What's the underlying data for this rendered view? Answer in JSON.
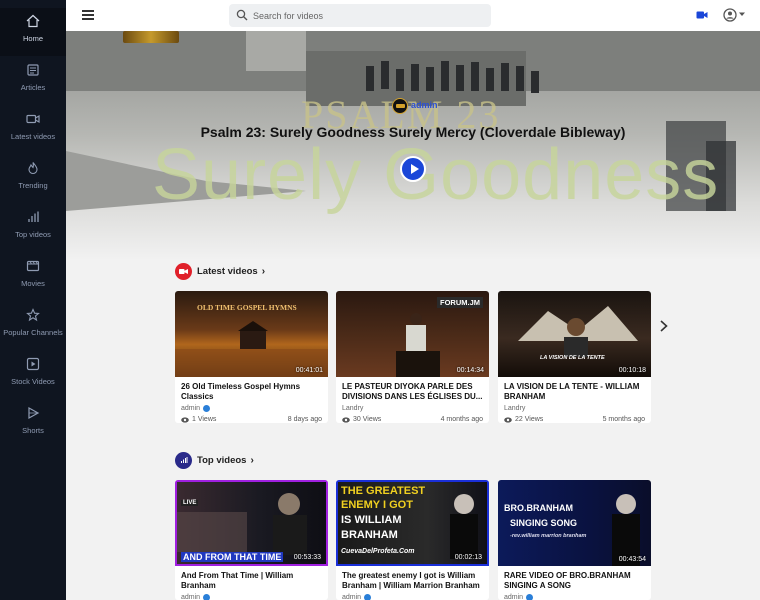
{
  "sidebar": {
    "items": [
      {
        "label": "Home",
        "icon": "home-icon"
      },
      {
        "label": "Articles",
        "icon": "article-icon"
      },
      {
        "label": "Latest videos",
        "icon": "video-camera-icon"
      },
      {
        "label": "Trending",
        "icon": "fire-icon"
      },
      {
        "label": "Top videos",
        "icon": "bar-chart-icon"
      },
      {
        "label": "Movies",
        "icon": "film-icon"
      },
      {
        "label": "Popular Channels",
        "icon": "star-icon"
      },
      {
        "label": "Stock Videos",
        "icon": "play-square-icon"
      },
      {
        "label": "Shorts",
        "icon": "shorts-icon"
      }
    ]
  },
  "header": {
    "search_placeholder": "Search for videos"
  },
  "hero": {
    "bg_text_top": "PSALM 23",
    "bg_text_big": "Surely Goodness",
    "channel": "admin",
    "title": "Psalm 23: Surely Goodness Surely Mercy (Cloverdale Bibleway)"
  },
  "latest": {
    "title": "Latest videos",
    "videos": [
      {
        "thumb_text": "OLD TIME GOSPEL HYMNS",
        "duration": "00:41:01",
        "title": "26 Old Timeless Gospel Hymns Classics",
        "author": "admin",
        "verified": true,
        "views": "1 Views",
        "age": "8 days ago"
      },
      {
        "thumb_text": "FORUM.JM",
        "duration": "00:14:34",
        "title": "LE PASTEUR DIYOKA PARLE DES DIVISIONS DANS LES ÉGLISES DU...",
        "author": "Landry",
        "verified": false,
        "views": "30 Views",
        "age": "4 months ago"
      },
      {
        "thumb_text": "LA VISION DE LA TENTE",
        "duration": "00:10:18",
        "title": "LA VISION DE LA TENTE - WILLIAM BRANHAM",
        "author": "Landry",
        "verified": false,
        "views": "22 Views",
        "age": "5 months ago"
      }
    ]
  },
  "top": {
    "title": "Top videos",
    "videos": [
      {
        "thumb_text_1": "LIVE",
        "thumb_text_2": "AND FROM THAT TIME",
        "duration": "00:53:33",
        "title": "And From That Time | William Branham",
        "author": "admin",
        "verified": true,
        "border": "#a020e0"
      },
      {
        "thumb_text_1": "THE GREATEST",
        "thumb_text_2": "ENEMY I GOT",
        "thumb_text_3": "IS WILLIAM",
        "thumb_text_4": "BRANHAM",
        "thumb_text_5": "CuevaDelProfeta.Com",
        "duration": "00:02:13",
        "title": "The greatest enemy I got is William Branham | William Marrion Branham",
        "author": "admin",
        "verified": true,
        "border": "#1a2fd8"
      },
      {
        "thumb_text_1": "BRO.BRANHAM",
        "thumb_text_2": "SINGING SONG",
        "thumb_text_3": "-rev.william marrion branham",
        "duration": "00:43:54",
        "title": "RARE VIDEO OF BRO.BRANHAM SINGING A SONG",
        "author": "admin",
        "verified": true,
        "border": ""
      }
    ]
  },
  "colors": {
    "sidebar_bg": "#0f1520",
    "accent": "#1a46d8",
    "latest_icon": "#e0202a",
    "top_icon": "#2a2a8a"
  }
}
